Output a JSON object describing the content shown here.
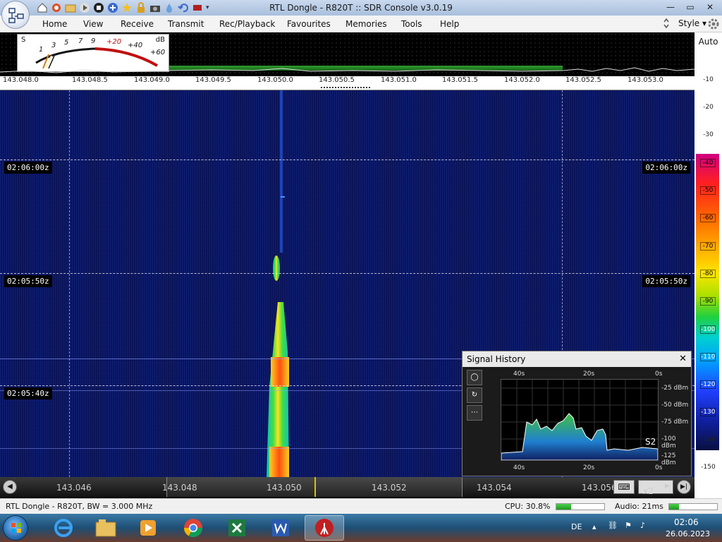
{
  "window": {
    "title": "RTL Dongle - R820T :: SDR Console v3.0.19",
    "minimize": "—",
    "maximize": "▭",
    "close": "✕"
  },
  "menu": {
    "items": [
      "Home",
      "View",
      "Receive",
      "Transmit",
      "Rec/Playback",
      "Favourites",
      "Memories",
      "Tools",
      "Help"
    ],
    "style_label": "Style"
  },
  "smeter": {
    "s_label": "S",
    "db_label": "dB",
    "scale_s": [
      "1",
      "3",
      "5",
      "7",
      "9"
    ],
    "scale_plus": [
      "+20",
      "+40",
      "+60"
    ]
  },
  "spectrum": {
    "auto_label": "Auto",
    "freq_ticks": [
      "143.048.0",
      "143.048.5",
      "143.049.0",
      "143.049.5",
      "143.050.0",
      "143.050.5",
      "143.051.0",
      "143.051.5",
      "143.052.0",
      "143.052.5",
      "143.053.0"
    ]
  },
  "db_scale": {
    "ticks_top": [
      "-10",
      "-20",
      "-30"
    ],
    "ticks_colorbar": [
      "-40",
      "-50",
      "-60",
      "-70",
      "-80",
      "-90",
      "-100",
      "-110",
      "-120",
      "-130"
    ],
    "ticks_bottom": [
      "-140",
      "-150"
    ]
  },
  "waterfall": {
    "time_labels": [
      "02:06:00z",
      "02:05:50z",
      "02:05:40z"
    ]
  },
  "scroll_axis": {
    "freqs": [
      "143.046",
      "143.048",
      "143.050",
      "143.052",
      "143.054",
      "143.056"
    ],
    "zoom_label": "x2"
  },
  "signal_history": {
    "title": "Signal History",
    "close": "✕",
    "top_ticks": [
      "40s",
      "20s",
      "0s"
    ],
    "bottom_ticks": [
      "40s",
      "20s",
      "0s"
    ],
    "y_ticks": [
      "-25 dBm",
      "-50 dBm",
      "-75 dBm",
      "-100 dBm",
      "-125 dBm"
    ],
    "s_label": "S2",
    "side_buttons": [
      "◯",
      "↻",
      "⋯"
    ]
  },
  "status": {
    "device": "RTL Dongle - R820T, BW = 3.000 MHz",
    "cpu_label": "CPU: 30.8%",
    "cpu_pct": 30.8,
    "audio_label": "Audio: 21ms",
    "audio_pct": 20
  },
  "taskbar": {
    "lang": "DE",
    "time": "02:06",
    "date": "26.06.2023"
  },
  "colors": {
    "waterfall_bg": "#0a1150",
    "signal_peak": "#ff4a00",
    "cpu_bar": "#2fb52f"
  }
}
